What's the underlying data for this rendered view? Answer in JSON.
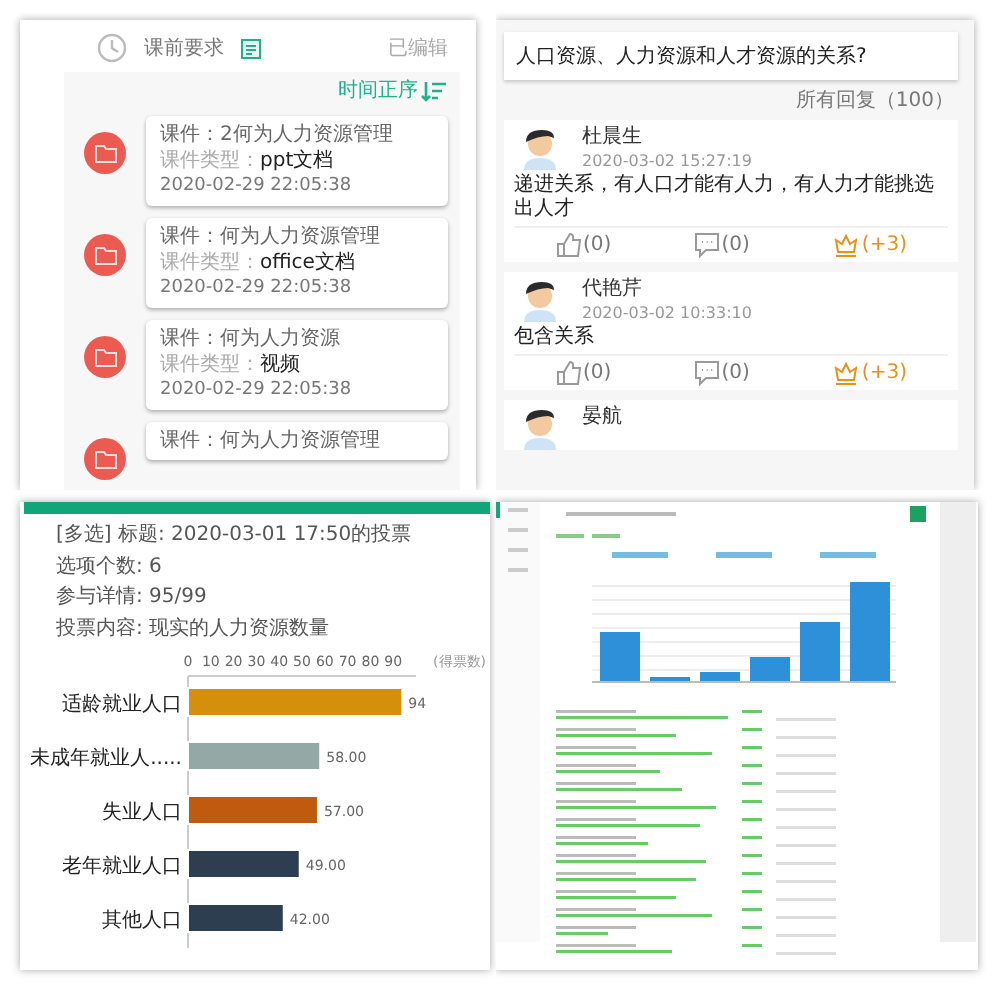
{
  "course_panel": {
    "header": {
      "title": "课前要求",
      "status": "已编辑"
    },
    "sort_label": "时间正序",
    "items": [
      {
        "title": "课件：2何为人力资源管理",
        "type_label": "课件类型：",
        "type": "ppt文档",
        "time": "2020-02-29 22:05:38"
      },
      {
        "title": "课件：何为人力资源管理",
        "type_label": "课件类型：",
        "type": "office文档",
        "time": "2020-02-29 22:05:38"
      },
      {
        "title": "课件：何为人力资源",
        "type_label": "课件类型：",
        "type": "视频",
        "time": "2020-02-29 22:05:38"
      },
      {
        "title": "课件：何为人力资源管理"
      }
    ]
  },
  "discussion_panel": {
    "question": "人口资源、人力资源和人才资源的关系?",
    "replies_count": "所有回复（100）",
    "replies": [
      {
        "name": "杜晨生",
        "time": "2020-03-02 15:27:19",
        "text": "递进关系，有人口才能有人力，有人力才能挑选出人才",
        "likes": "(0)",
        "comments": "(0)",
        "reward": "(+3)"
      },
      {
        "name": "代艳芹",
        "time": "2020-03-02 10:33:10",
        "text": "包含关系",
        "likes": "(0)",
        "comments": "(0)",
        "reward": "(+3)"
      },
      {
        "name": "晏航"
      }
    ]
  },
  "vote_panel": {
    "lines": [
      "[多选] 标题: 2020-03-01 17:50的投票",
      "选项个数: 6",
      "参与详情: 95/99",
      "投票内容: 现实的人力资源数量"
    ],
    "chart_data": {
      "type": "bar",
      "orientation": "horizontal",
      "xlabel": "(得票数)",
      "categories": [
        "适龄就业人口",
        "未成年就业人.....",
        "失业人口",
        "老年就业人口",
        "其他人口"
      ],
      "colors": [
        "#d4900a",
        "#93a9a6",
        "#c05a0e",
        "#2c3e50",
        "#2c3e50"
      ],
      "series": [
        {
          "values": [
            94,
            58,
            57,
            49,
            42
          ]
        }
      ],
      "value_labels": [
        "94",
        "58.00",
        "57.00",
        "49.00",
        "42.00"
      ],
      "xlim": [
        0,
        100
      ],
      "xticks": [
        0,
        10,
        20,
        30,
        40,
        50,
        60,
        70,
        80,
        90
      ]
    }
  }
}
